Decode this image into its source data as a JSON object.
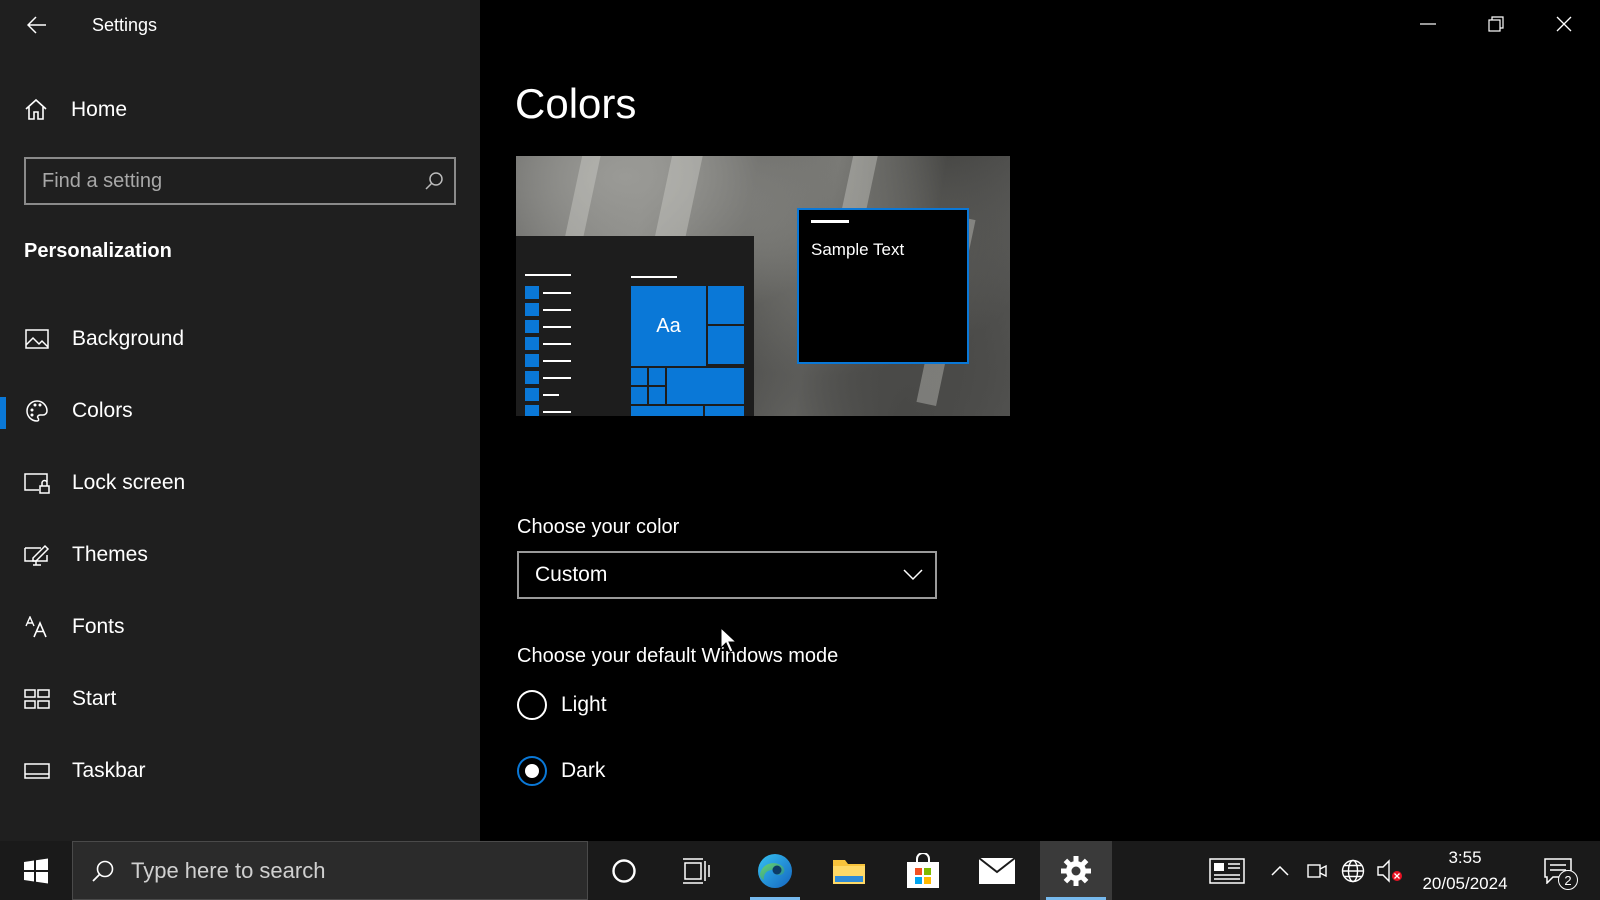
{
  "window": {
    "app_title": "Settings",
    "back_icon": "back-arrow-icon",
    "controls": [
      "minimize",
      "restore",
      "close"
    ]
  },
  "sidebar": {
    "home_label": "Home",
    "search_placeholder": "Find a setting",
    "section_heading": "Personalization",
    "items": [
      {
        "label": "Background",
        "icon": "picture-icon"
      },
      {
        "label": "Colors",
        "icon": "palette-icon",
        "active": true
      },
      {
        "label": "Lock screen",
        "icon": "lock-screen-icon"
      },
      {
        "label": "Themes",
        "icon": "themes-icon"
      },
      {
        "label": "Fonts",
        "icon": "fonts-icon"
      },
      {
        "label": "Start",
        "icon": "start-icon"
      },
      {
        "label": "Taskbar",
        "icon": "taskbar-icon"
      }
    ]
  },
  "main": {
    "page_title": "Colors",
    "preview": {
      "sample_text": "Sample Text",
      "tile_label": "Aa"
    },
    "choose_color_label": "Choose your color",
    "choose_color_value": "Custom",
    "windows_mode_label": "Choose your default Windows mode",
    "mode_options": [
      {
        "label": "Light",
        "selected": false
      },
      {
        "label": "Dark",
        "selected": true
      }
    ]
  },
  "taskbar": {
    "search_placeholder": "Type here to search",
    "pinned": [
      "cortana-icon",
      "task-view-icon",
      "edge-icon",
      "file-explorer-icon",
      "store-icon",
      "mail-icon",
      "settings-icon"
    ],
    "clock_time": "3:55",
    "clock_date": "20/05/2024",
    "notification_count": "2"
  },
  "colors": {
    "accent": "#0a78d7",
    "sidebar_bg": "#1f1f1f",
    "main_bg": "#000000",
    "taskbar_bg": "#1a1a1a"
  }
}
